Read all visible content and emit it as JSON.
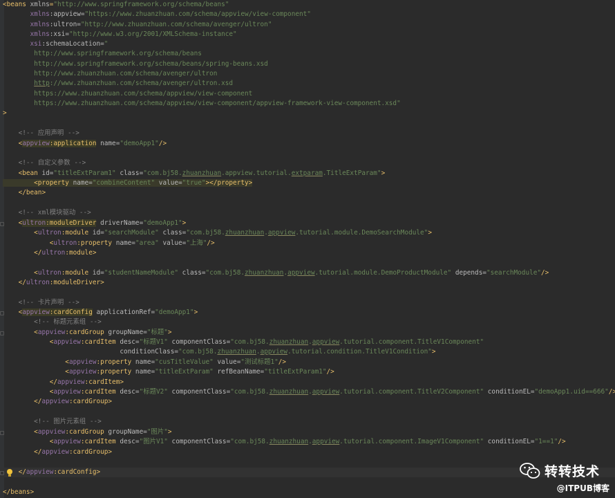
{
  "lines": [
    [
      [
        "tag",
        "<beans "
      ],
      [
        "attr",
        "xmlns"
      ],
      [
        "tag",
        "="
      ],
      [
        "val",
        "\"http://www.springframework.org/schema/beans\""
      ]
    ],
    [
      [
        "tag",
        "       "
      ],
      [
        "ns",
        "xmlns"
      ],
      [
        "attr",
        ":appview="
      ],
      [
        "val",
        "\"https://www.zhuanzhuan.com/schema/appview/view-component\""
      ]
    ],
    [
      [
        "tag",
        "       "
      ],
      [
        "ns",
        "xmlns"
      ],
      [
        "attr",
        ":ultron="
      ],
      [
        "val",
        "\"http://www.zhuanzhuan.com/schema/avenger/ultron\""
      ]
    ],
    [
      [
        "tag",
        "       "
      ],
      [
        "ns",
        "xmlns"
      ],
      [
        "attr",
        ":xsi="
      ],
      [
        "val",
        "\"http://www.w3.org/2001/XMLSchema-instance\""
      ]
    ],
    [
      [
        "tag",
        "       "
      ],
      [
        "ns",
        "xsi"
      ],
      [
        "attr",
        ":schemaLocation="
      ],
      [
        "val",
        "\""
      ]
    ],
    [
      [
        "val",
        "        http://www.springframework.org/schema/beans"
      ]
    ],
    [
      [
        "val",
        "        http://www.springframework.org/schema/beans/spring-beans.xsd"
      ]
    ],
    [
      [
        "val",
        "        http://www.zhuanzhuan.com/schema/avenger/ultron"
      ]
    ],
    [
      [
        "val",
        "        "
      ],
      [
        "val und",
        "http"
      ],
      [
        "val",
        "://www.zhuanzhuan.com/schema/avenger/ultron.xsd"
      ]
    ],
    [
      [
        "val",
        "        https://www.zhuanzhuan.com/schema/appview/view-component"
      ]
    ],
    [
      [
        "val",
        "        https://www.zhuanzhuan.com/schema/appview/view-component/appview-framework-view-component.xsd\""
      ]
    ],
    [
      [
        "tag",
        ">"
      ]
    ],
    [
      [
        "tag",
        ""
      ]
    ],
    [
      [
        "cmt",
        "    <!-- 应用声明 -->"
      ]
    ],
    [
      [
        "tag",
        "    <"
      ],
      [
        "ns hl",
        "appview"
      ],
      [
        "tag hl",
        ":application"
      ],
      [
        "attr",
        " name="
      ],
      [
        "val",
        "\"demoApp1\""
      ],
      [
        "tag",
        "/>"
      ]
    ],
    [
      [
        "tag",
        ""
      ]
    ],
    [
      [
        "cmt",
        "    <!-- 自定义参数 -->"
      ]
    ],
    [
      [
        "tag",
        "    <bean "
      ],
      [
        "attr",
        "id="
      ],
      [
        "val",
        "\"titleExtParam1\""
      ],
      [
        "attr",
        " class="
      ],
      [
        "val",
        "\"com.bj58."
      ],
      [
        "val und",
        "zhuanzhuan"
      ],
      [
        "val",
        ".appview.tutorial."
      ],
      [
        "val und",
        "extparam"
      ],
      [
        "val",
        ".TitleExtParam\""
      ],
      [
        "tag",
        ">"
      ]
    ],
    [
      [
        "tag hlv",
        "        <property "
      ],
      [
        "attr hlv",
        "name="
      ],
      [
        "val hlv",
        "\"combineContent\""
      ],
      [
        "attr hlv",
        " value="
      ],
      [
        "val hlv",
        "\"true\""
      ],
      [
        "tag hlv",
        "></property>"
      ]
    ],
    [
      [
        "tag",
        "    </bean>"
      ]
    ],
    [
      [
        "tag",
        ""
      ]
    ],
    [
      [
        "cmt",
        "    <!-- xml模块驱动 -->"
      ]
    ],
    [
      [
        "tag",
        "    <"
      ],
      [
        "ns hl",
        "ultron"
      ],
      [
        "tag hl",
        ":moduleDriver"
      ],
      [
        "attr",
        " driverName="
      ],
      [
        "val",
        "\"demoApp1\""
      ],
      [
        "tag",
        ">"
      ]
    ],
    [
      [
        "tag",
        "        <"
      ],
      [
        "ns",
        "ultron"
      ],
      [
        "tag",
        ":module "
      ],
      [
        "attr",
        "id="
      ],
      [
        "val",
        "\"searchModule\""
      ],
      [
        "attr",
        " class="
      ],
      [
        "val",
        "\"com.bj58."
      ],
      [
        "val und",
        "zhuanzhuan"
      ],
      [
        "val",
        "."
      ],
      [
        "val und",
        "appview"
      ],
      [
        "val",
        ".tutorial.module.DemoSearchModule\""
      ],
      [
        "tag",
        ">"
      ]
    ],
    [
      [
        "tag",
        "            <"
      ],
      [
        "ns",
        "ultron"
      ],
      [
        "tag",
        ":property "
      ],
      [
        "attr",
        "name="
      ],
      [
        "val",
        "\"area\""
      ],
      [
        "attr",
        " value="
      ],
      [
        "val",
        "\"上海\""
      ],
      [
        "tag",
        "/>"
      ]
    ],
    [
      [
        "tag",
        "        </"
      ],
      [
        "ns",
        "ultron"
      ],
      [
        "tag",
        ":module>"
      ]
    ],
    [
      [
        "tag",
        ""
      ]
    ],
    [
      [
        "tag",
        "        <"
      ],
      [
        "ns",
        "ultron"
      ],
      [
        "tag",
        ":module "
      ],
      [
        "attr",
        "id="
      ],
      [
        "val",
        "\"studentNameModule\""
      ],
      [
        "attr",
        " class="
      ],
      [
        "val",
        "\"com.bj58."
      ],
      [
        "val und",
        "zhuanzhuan"
      ],
      [
        "val",
        "."
      ],
      [
        "val und",
        "appview"
      ],
      [
        "val",
        ".tutorial.module.DemoProductModule\""
      ],
      [
        "attr",
        " depends="
      ],
      [
        "val",
        "\"searchModule\""
      ],
      [
        "tag",
        "/>"
      ]
    ],
    [
      [
        "tag",
        "    </"
      ],
      [
        "ns",
        "ultron"
      ],
      [
        "tag",
        ":moduleDriver>"
      ]
    ],
    [
      [
        "tag",
        ""
      ]
    ],
    [
      [
        "cmt",
        "    <!-- 卡片声明 -->"
      ]
    ],
    [
      [
        "tag",
        "    <"
      ],
      [
        "ns hl",
        "appview"
      ],
      [
        "tag hl",
        ":cardConfig"
      ],
      [
        "attr",
        " applicationRef="
      ],
      [
        "val",
        "\"demoApp1\""
      ],
      [
        "tag",
        ">"
      ]
    ],
    [
      [
        "cmt",
        "        <!-- 标题元素组 -->"
      ]
    ],
    [
      [
        "tag",
        "        <"
      ],
      [
        "ns",
        "appview"
      ],
      [
        "tag",
        ":cardGroup "
      ],
      [
        "attr",
        "groupName="
      ],
      [
        "val",
        "\"标题\""
      ],
      [
        "tag",
        ">"
      ]
    ],
    [
      [
        "tag",
        "            <"
      ],
      [
        "ns",
        "appview"
      ],
      [
        "tag",
        ":cardItem "
      ],
      [
        "attr",
        "desc="
      ],
      [
        "val",
        "\"标题V1\""
      ],
      [
        "attr",
        " componentClass="
      ],
      [
        "val",
        "\"com.bj58."
      ],
      [
        "val und",
        "zhuanzhuan"
      ],
      [
        "val",
        "."
      ],
      [
        "val und",
        "appview"
      ],
      [
        "val",
        ".tutorial.component.TitleV1Component\""
      ]
    ],
    [
      [
        "attr",
        "                              conditionClass="
      ],
      [
        "val",
        "\"com.bj58."
      ],
      [
        "val und",
        "zhuanzhuan"
      ],
      [
        "val",
        "."
      ],
      [
        "val und",
        "appview"
      ],
      [
        "val",
        ".tutorial.condition.TitleV1Condition\""
      ],
      [
        "tag",
        ">"
      ]
    ],
    [
      [
        "tag",
        "                <"
      ],
      [
        "ns",
        "appview"
      ],
      [
        "tag",
        ":property "
      ],
      [
        "attr",
        "name="
      ],
      [
        "val",
        "\"cusTitleValue\""
      ],
      [
        "attr",
        " value="
      ],
      [
        "val",
        "\"测试标题1\""
      ],
      [
        "tag",
        "/>"
      ]
    ],
    [
      [
        "tag",
        "                <"
      ],
      [
        "ns",
        "appview"
      ],
      [
        "tag",
        ":property "
      ],
      [
        "attr",
        "name="
      ],
      [
        "val",
        "\"titleExtParam\""
      ],
      [
        "attr",
        " refBeanName="
      ],
      [
        "val",
        "\"titleExtParam1\""
      ],
      [
        "tag",
        "/>"
      ]
    ],
    [
      [
        "tag",
        "            </"
      ],
      [
        "ns",
        "appview"
      ],
      [
        "tag",
        ":cardItem>"
      ]
    ],
    [
      [
        "tag",
        "            <"
      ],
      [
        "ns",
        "appview"
      ],
      [
        "tag",
        ":cardItem "
      ],
      [
        "attr",
        "desc="
      ],
      [
        "val",
        "\"标题V2\""
      ],
      [
        "attr",
        " componentClass="
      ],
      [
        "val",
        "\"com.bj58."
      ],
      [
        "val und",
        "zhuanzhuan"
      ],
      [
        "val",
        "."
      ],
      [
        "val und",
        "appview"
      ],
      [
        "val",
        ".tutorial.component.TitleV2Component\""
      ],
      [
        "attr",
        " conditionEL="
      ],
      [
        "val",
        "\"demoApp1.uid==666\""
      ],
      [
        "tag",
        "/>"
      ]
    ],
    [
      [
        "tag",
        "        </"
      ],
      [
        "ns",
        "appview"
      ],
      [
        "tag",
        ":cardGroup>"
      ]
    ],
    [
      [
        "tag",
        ""
      ]
    ],
    [
      [
        "cmt",
        "        <!-- 图片元素组 -->"
      ]
    ],
    [
      [
        "tag",
        "        <"
      ],
      [
        "ns",
        "appview"
      ],
      [
        "tag",
        ":cardGroup "
      ],
      [
        "attr",
        "groupName="
      ],
      [
        "val",
        "\"图片\""
      ],
      [
        "tag",
        ">"
      ]
    ],
    [
      [
        "tag",
        "            <"
      ],
      [
        "ns",
        "appview"
      ],
      [
        "tag",
        ":cardItem "
      ],
      [
        "attr",
        "desc="
      ],
      [
        "val",
        "\"图片V1\""
      ],
      [
        "attr",
        " componentClass="
      ],
      [
        "val",
        "\"com.bj58."
      ],
      [
        "val und",
        "zhuanzhuan"
      ],
      [
        "val",
        "."
      ],
      [
        "val und",
        "appview"
      ],
      [
        "val",
        ".tutorial.component.ImageV1Component\""
      ],
      [
        "attr",
        " conditionEL="
      ],
      [
        "val",
        "\"1==1\""
      ],
      [
        "tag",
        "/>"
      ]
    ],
    [
      [
        "tag",
        "        </"
      ],
      [
        "ns",
        "appview"
      ],
      [
        "tag",
        ":cardGroup>"
      ]
    ],
    [
      [
        "tag",
        ""
      ]
    ],
    [
      [
        "tag",
        "    </"
      ],
      [
        "ns",
        "appview"
      ],
      [
        "tag",
        ":cardConfig>"
      ]
    ],
    [
      [
        "tag",
        ""
      ]
    ],
    [
      [
        "tag",
        "</beans>"
      ]
    ]
  ],
  "watermark": {
    "brand": "转转技术",
    "sub": "@ITPUB博客"
  },
  "colors": {
    "background": "#2b2b2b",
    "tag": "#e8bf6a",
    "attribute": "#bababa",
    "value": "#6a8759",
    "namespace": "#9876aa",
    "comment": "#808080"
  },
  "icons": {
    "intention": "lightbulb-icon",
    "watermark": "wechat-icon"
  }
}
